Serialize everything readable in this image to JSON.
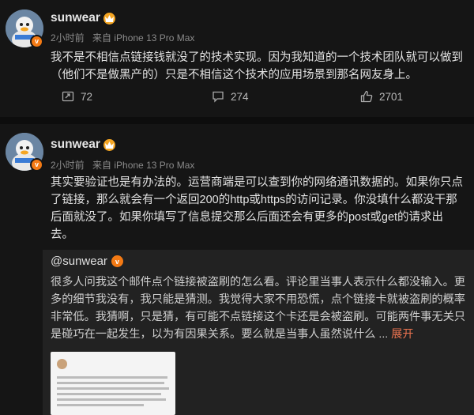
{
  "post1": {
    "username": "sunwear",
    "time": "2小时前",
    "source": "来自 iPhone 13 Pro Max",
    "text": "我不是不相信点链接钱就没了的技术实现。因为我知道的一个技术团队就可以做到（他们不是做黑产的）只是不相信这个技术的应用场景到那名网友身上。",
    "actions": {
      "repost_count": "72",
      "comment_count": "274",
      "like_count": "2701"
    },
    "icons": [
      "repost-icon",
      "comment-icon",
      "like-icon"
    ]
  },
  "post2": {
    "username": "sunwear",
    "time": "2小时前",
    "source": "来自 iPhone 13 Pro Max",
    "text": "其实要验证也是有办法的。运营商端是可以查到你的网络通讯数据的。如果你只点了链接，那么就会有一个返回200的http或https的访问记录。你没填什么都没干那后面就没了。如果你填写了信息提交那么后面还会有更多的post或get的请求出去。",
    "repost": {
      "mention": "@sunwear",
      "text": "很多人问我这个邮件点个链接被盗刷的怎么看。评论里当事人表示什么都没输入。更多的细节我没有，我只能是猜测。我觉得大家不用恐慌，点个链接卡就被盗刷的概率非常低。我猜啊，只是猜，有可能不点链接这个卡还是会被盗刷。可能两件事无关只是碰巧在一起发生，以为有因果关系。要么就是当事人虽然说什么",
      "expand_label": "展开"
    }
  },
  "colors": {
    "background": "#151515",
    "repost_bg": "#222222",
    "accent": "#eb7350",
    "verified": "#f47a14"
  }
}
